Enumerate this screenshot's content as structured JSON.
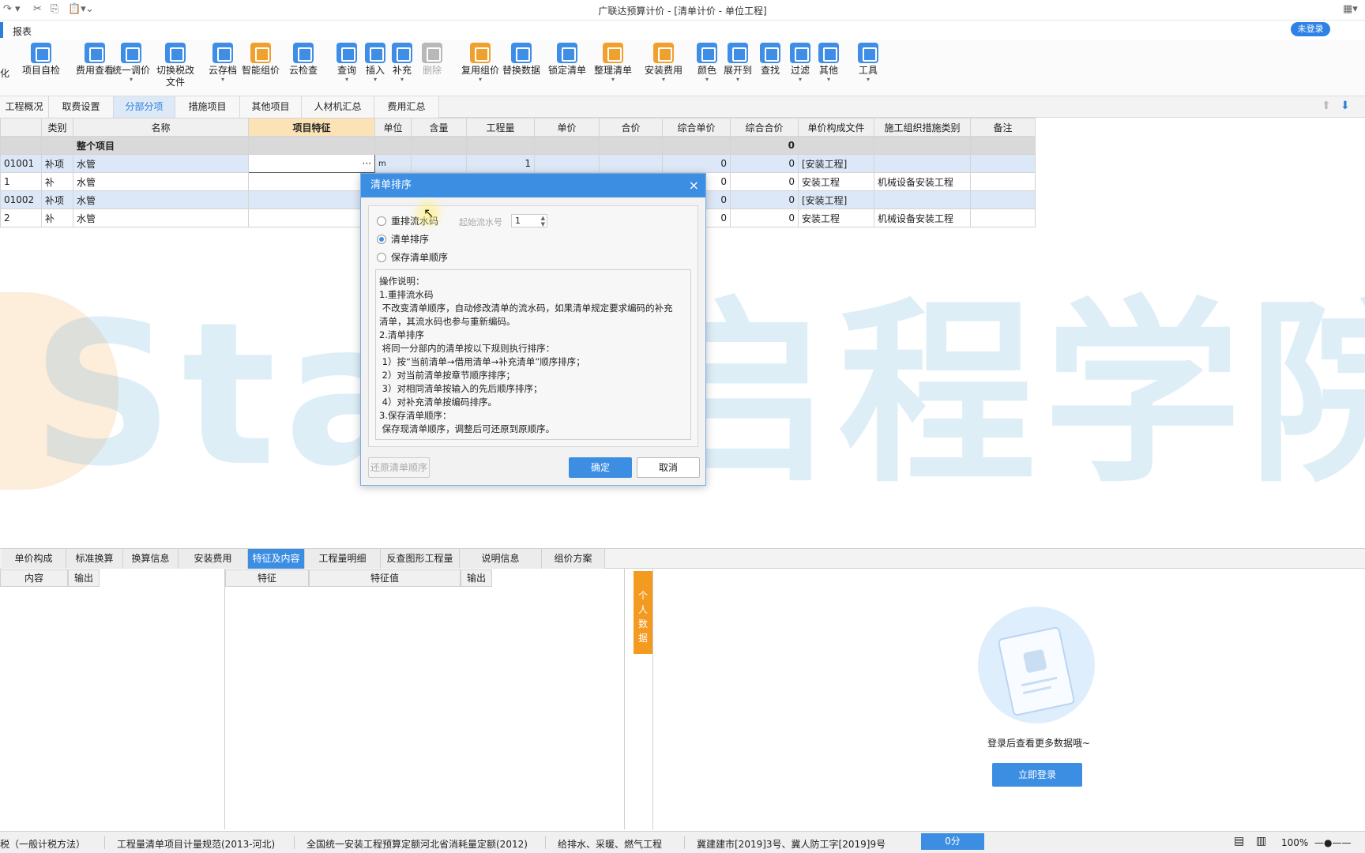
{
  "window": {
    "title": "广联达预算计价 - [清单计价 - 单位工程]",
    "login_badge": "未登录"
  },
  "menu": {
    "item": "报表"
  },
  "toolbar": [
    {
      "label": "项目自检",
      "icon": "check-icon",
      "color": "b",
      "dd": false
    },
    {
      "label": "费用查看",
      "icon": "fee-icon",
      "color": "b",
      "dd": false
    },
    {
      "label": "统一调价",
      "icon": "price-adjust-icon",
      "color": "b",
      "dd": true
    },
    {
      "label": "切换税改文件",
      "icon": "tax-switch-icon",
      "color": "b",
      "dd": false
    },
    {
      "label": "云存档",
      "icon": "cloud-save-icon",
      "color": "b",
      "dd": true
    },
    {
      "label": "智能组价",
      "icon": "smart-price-icon",
      "color": "o",
      "dd": false
    },
    {
      "label": "云检查",
      "icon": "cloud-check-icon",
      "color": "b",
      "dd": false
    },
    {
      "label": "查询",
      "icon": "query-icon",
      "color": "b",
      "dd": true
    },
    {
      "label": "插入",
      "icon": "insert-icon",
      "color": "b",
      "dd": true
    },
    {
      "label": "补充",
      "icon": "supplement-icon",
      "color": "b",
      "dd": true
    },
    {
      "label": "删除",
      "icon": "delete-icon",
      "color": "g",
      "dd": false
    },
    {
      "label": "复用组价",
      "icon": "reuse-price-icon",
      "color": "o",
      "dd": true
    },
    {
      "label": "替换数据",
      "icon": "replace-data-icon",
      "color": "b",
      "dd": false
    },
    {
      "label": "锁定清单",
      "icon": "lock-icon",
      "color": "b",
      "dd": false
    },
    {
      "label": "整理清单",
      "icon": "organize-icon",
      "color": "o",
      "dd": true
    },
    {
      "label": "安装费用",
      "icon": "install-fee-icon",
      "color": "o",
      "dd": true
    },
    {
      "label": "颜色",
      "icon": "color-icon",
      "color": "b",
      "dd": true
    },
    {
      "label": "展开到",
      "icon": "expand-icon",
      "color": "b",
      "dd": true
    },
    {
      "label": "查找",
      "icon": "find-icon",
      "color": "b",
      "dd": false
    },
    {
      "label": "过滤",
      "icon": "filter-icon",
      "color": "b",
      "dd": true
    },
    {
      "label": "其他",
      "icon": "other-icon",
      "color": "b",
      "dd": true
    },
    {
      "label": "工具",
      "icon": "tools-icon",
      "color": "b",
      "dd": true
    }
  ],
  "toolbar_left_fragment": "化",
  "page_tabs": [
    "工程概况",
    "取费设置",
    "分部分项",
    "措施项目",
    "其他项目",
    "人材机汇总",
    "费用汇总"
  ],
  "active_page_tab": "分部分项",
  "grid": {
    "headers": [
      "",
      "类别",
      "名称",
      "项目特征",
      "单位",
      "含量",
      "工程量",
      "单价",
      "合价",
      "综合单价",
      "综合合价",
      "单价构成文件",
      "施工组织措施类别",
      "备注"
    ],
    "group_row": {
      "name": "整个项目",
      "total": "0"
    },
    "rows": [
      {
        "code": "01001",
        "type": "补项",
        "name": "水管",
        "feature": "",
        "unit": "m",
        "qty_ratio": "",
        "qty": "1",
        "price": "",
        "amount": "",
        "unit_total": "0",
        "total": "0",
        "file": "[安装工程]",
        "measure": "",
        "note": ""
      },
      {
        "code": "1",
        "type": "补",
        "name": "水管",
        "feature": "",
        "unit": "",
        "qty_ratio": "",
        "qty": "",
        "price": "",
        "amount": "",
        "unit_total": "0",
        "total": "0",
        "file": "安装工程",
        "measure": "机械设备安装工程",
        "note": ""
      },
      {
        "code": "01002",
        "type": "补项",
        "name": "水管",
        "feature": "",
        "unit": "",
        "qty_ratio": "",
        "qty": "",
        "price": "",
        "amount": "",
        "unit_total": "0",
        "total": "0",
        "file": "[安装工程]",
        "measure": "",
        "note": ""
      },
      {
        "code": "2",
        "type": "补",
        "name": "水管",
        "feature": "",
        "unit": "",
        "qty_ratio": "",
        "qty": "",
        "price": "",
        "amount": "",
        "unit_total": "0",
        "total": "0",
        "file": "安装工程",
        "measure": "机械设备安装工程",
        "note": ""
      }
    ]
  },
  "watermark": "Start启程学院",
  "dialog": {
    "title": "清单排序",
    "options": [
      "重排流水码",
      "清单排序",
      "保存清单顺序"
    ],
    "selected": "清单排序",
    "start_label": "起始流水号",
    "start_value": "1",
    "description": [
      "操作说明：",
      "1.重排流水码",
      " 不改变清单顺序，自动修改清单的流水码，如果清单规定要求编码的补充",
      "清单，其流水码也参与重新编码。",
      "2.清单排序",
      " 将同一分部内的清单按以下规则执行排序：",
      " 1）按“当前清单→借用清单→补充清单”顺序排序；",
      " 2）对当前清单按章节顺序排序；",
      " 3）对相同清单按输入的先后顺序排序；",
      " 4）对补充清单按编码排序。",
      "3.保存清单顺序：",
      " 保存现清单顺序，调整后可还原到原顺序。"
    ],
    "restore_btn": "还原清单顺序",
    "ok_btn": "确定",
    "cancel_btn": "取消"
  },
  "bottom_tabs": [
    "单价构成",
    "标准换算",
    "换算信息",
    "安装费用",
    "特征及内容",
    "工程量明细",
    "反查图形工程量",
    "说明信息",
    "组价方案"
  ],
  "active_bottom_tab": "特征及内容",
  "sub_headers": {
    "content": "内容",
    "output1": "输出",
    "feature": "特征",
    "feature_value": "特征值",
    "output2": "输出"
  },
  "side_tab": "个人数据",
  "login_panel": {
    "tip": "登录后查看更多数据哦~",
    "button": "立即登录"
  },
  "status": {
    "items": [
      "税（一般计税方法）",
      "工程量清单项目计量规范(2013-河北)",
      "全国统一安装工程预算定额河北省消耗量定额(2012)",
      "给排水、采暖、燃气工程",
      "冀建建市[2019]3号、冀人防工字[2019]9号"
    ],
    "score": "0分",
    "zoom": "100%"
  }
}
